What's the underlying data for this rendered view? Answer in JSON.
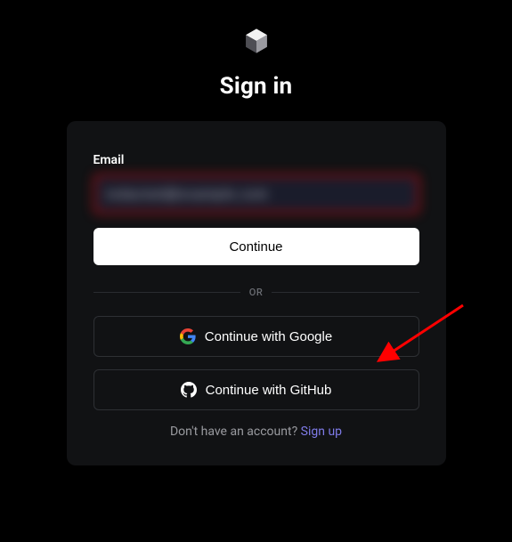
{
  "header": {
    "title": "Sign in"
  },
  "form": {
    "email_label": "Email",
    "email_value": "redacted@example.com",
    "continue_label": "Continue",
    "divider_text": "OR",
    "google_label": "Continue with Google",
    "github_label": "Continue with GitHub"
  },
  "footer": {
    "prompt": "Don't have an account? ",
    "signup_link": "Sign up"
  }
}
